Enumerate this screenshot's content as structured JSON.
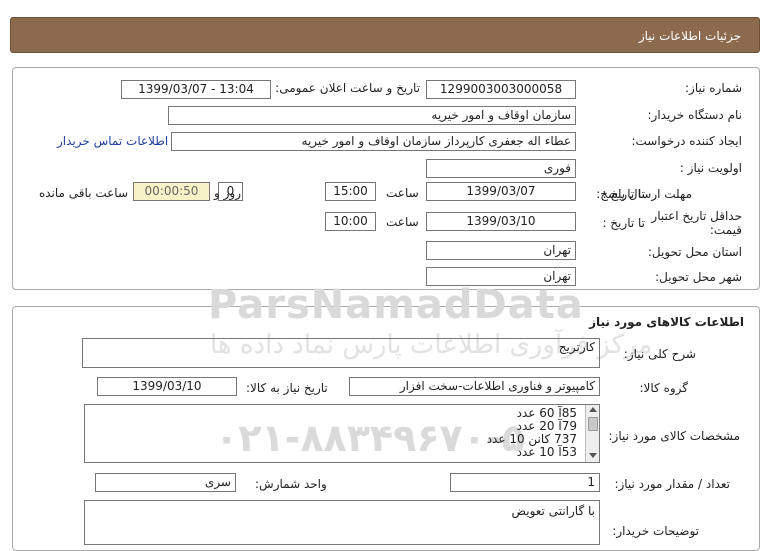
{
  "header": {
    "title": "جزئیات اطلاعات نیاز"
  },
  "info": {
    "need_no_label": "شماره نیاز:",
    "need_no": "1299003003000058",
    "announce_label": "تاریخ و ساعت اعلان عمومی:",
    "announce": "1399/03/07 - 13:04",
    "buyer_label": "نام دستگاه خریدار:",
    "buyer": "سازمان اوقاف و امور خیریه",
    "creator_label": "ایجاد کننده درخواست:",
    "creator": "عطاء اله جعفری کارپرداز سازمان اوقاف و امور خیریه",
    "contact_link": "اطلاعات تماس خریدار",
    "priority_label": "اولویت نیاز :",
    "priority": "فوری",
    "deadline_label": "مهلت ارسال پاسخ:",
    "to_date_label": "تا تاریخ :",
    "deadline_date": "1399/03/07",
    "time_label": "ساعت",
    "deadline_time": "15:00",
    "days": "0",
    "days_label": "روز و",
    "remaining": "00:00:50",
    "remaining_label": "ساعت باقی مانده",
    "validity_label": "حداقل تاریخ اعتبار قیمت:",
    "validity_date": "1399/03/10",
    "validity_time": "10:00",
    "province_label": "استان محل تحویل:",
    "province": "تهران",
    "city_label": "شهر محل تحویل:",
    "city": "تهران"
  },
  "watermark": {
    "brand": "ParsNamadData",
    "line1": "مرکز فرآوری اطلاعات پارس نماد داده ها",
    "phone": "۰۲۱-۸۸۳۴۹۶۷۰-۵"
  },
  "goods": {
    "section_title": "اطلاعات کالاهای مورد نیاز",
    "desc_label": "شرح کلی نیاز:",
    "desc": "کارتریج",
    "group_label": "گروه کالا:",
    "group": "کامپیوتر و فناوری اطلاعات-سخت افزار",
    "need_date_label": "تاریخ نیاز به کالا:",
    "need_date": "1399/03/10",
    "specs_label": "مشخصات کالای مورد نیاز:",
    "specs": [
      "85آ 60 عدد",
      "79آ   20 عدد",
      "737 کانن 10 عدد",
      "53آ   10 عدد"
    ],
    "qty_label": "تعداد / مقدار مورد نیاز:",
    "qty": "1",
    "unit_label": "واحد شمارش:",
    "unit": "سری",
    "notes_label": "توضیحات خریدار:",
    "notes": "با گارانتی تعویض"
  }
}
